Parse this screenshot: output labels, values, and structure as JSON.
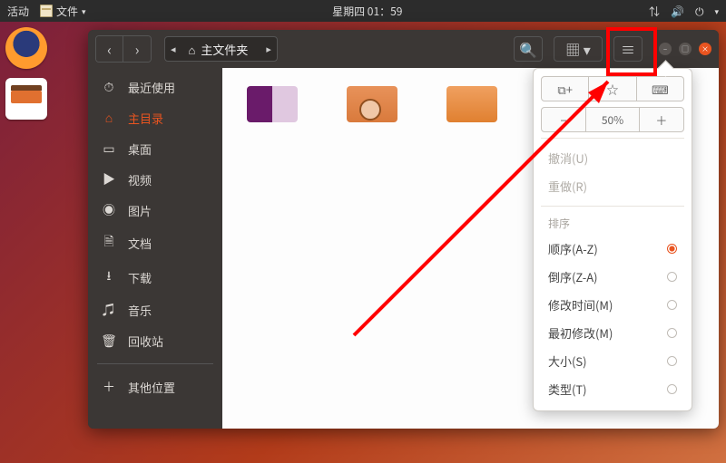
{
  "top_panel": {
    "activities": "活动",
    "app_name": "文件",
    "clock": "星期四 01：59"
  },
  "window": {
    "path": "主文件夹",
    "sidebar": [
      {
        "icon": "⏱",
        "label": "最近使用"
      },
      {
        "icon": "⌂",
        "label": "主目录",
        "selected": true
      },
      {
        "icon": "▭",
        "label": "桌面"
      },
      {
        "icon": "▶",
        "label": "视频"
      },
      {
        "icon": "◉",
        "label": "图片"
      },
      {
        "icon": "🗎",
        "label": "文档"
      },
      {
        "icon": "⭳",
        "label": "下载"
      },
      {
        "icon": "♫",
        "label": "音乐"
      },
      {
        "icon": "🗑",
        "label": "回收站"
      },
      {
        "icon": "＋",
        "label": "其他位置"
      }
    ]
  },
  "popover": {
    "zoom_label": "50%",
    "undo": "撤消(U)",
    "redo": "重做(R)",
    "sort_header": "排序",
    "sort_options": [
      {
        "label": "顺序(A-Z)",
        "checked": true
      },
      {
        "label": "倒序(Z-A)",
        "checked": false
      },
      {
        "label": "修改时间(M)",
        "checked": false
      },
      {
        "label": "最初修改(M)",
        "checked": false
      },
      {
        "label": "大小(S)",
        "checked": false
      },
      {
        "label": "类型(T)",
        "checked": false
      }
    ]
  }
}
